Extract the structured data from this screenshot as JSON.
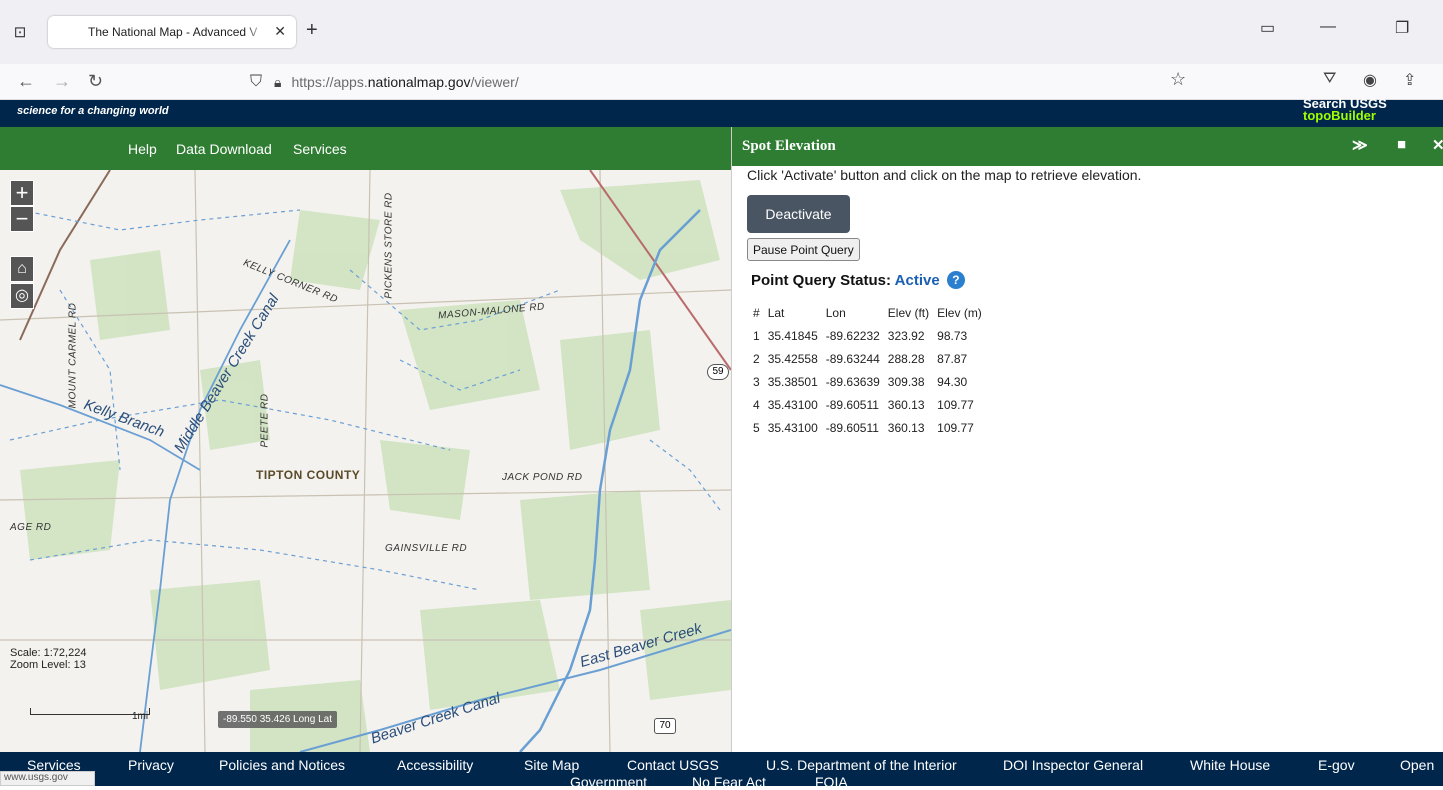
{
  "browser": {
    "tab_title": "The National Map - Advanced V",
    "url_prefix": "https://apps.",
    "url_domain": "nationalmap.gov",
    "url_path": "/viewer/",
    "icons": [
      "tab-list-icon",
      "close-icon",
      "new-tab-icon",
      "back-icon",
      "forward-icon",
      "reload-icon",
      "shield-icon",
      "lock-icon",
      "bookmark-star-icon",
      "pocket-icon",
      "account-icon",
      "share-icon"
    ]
  },
  "header": {
    "slogan": "science for a changing world",
    "search_usgs": "Search USGS",
    "topobuilder": "topoBuilder"
  },
  "menu": {
    "help": "Help",
    "data_download": "Data Download",
    "services": "Services"
  },
  "map": {
    "scale": "Scale: 1:72,224",
    "zoom": "Zoom Level: 13",
    "scale_unit": "1mi",
    "coords": "-89.550 35.426 Long Lat",
    "labels": {
      "kelly_corner": "KELLY CORNER RD",
      "pickens": "PICKENS STORE RD",
      "mason": "MASON-MALONE RD",
      "mount_carmel": "MOUNT CARMEL RD",
      "peete": "PEETE RD",
      "jack_pond": "JACK POND RD",
      "gainsville": "GAINSVILLE RD",
      "age": "AGE RD",
      "county": "TIPTON COUNTY",
      "kelly_branch": "Kelly Branch",
      "middle_beaver": "Middle Beaver Creek Canal",
      "east_beaver": "East Beaver Creek",
      "beaver_canal": "Beaver Creek Canal",
      "route_59": "59",
      "route_70": "70"
    }
  },
  "panel": {
    "title": "Spot Elevation",
    "instructions": "Click 'Activate' button and click on the map to retrieve elevation.",
    "deactivate": "Deactivate",
    "pause": "Pause Point Query",
    "status_label": "Point Query Status:",
    "status_value": "Active",
    "help": "?",
    "columns": [
      "#",
      "Lat",
      "Lon",
      "Elev (ft)",
      "Elev (m)"
    ],
    "rows": [
      [
        "1",
        "35.41845",
        "-89.62232",
        "323.92",
        "98.73"
      ],
      [
        "2",
        "35.42558",
        "-89.63244",
        "288.28",
        "87.87"
      ],
      [
        "3",
        "35.38501",
        "-89.63639",
        "309.38",
        "94.30"
      ],
      [
        "4",
        "35.43100",
        "-89.60511",
        "360.13",
        "109.77"
      ],
      [
        "5",
        "35.43100",
        "-89.60511",
        "360.13",
        "109.77"
      ]
    ]
  },
  "footer": {
    "services": "Services",
    "privacy": "Privacy",
    "policies": "Policies and Notices",
    "accessibility": "Accessibility",
    "sitemap": "Site Map",
    "contact": "Contact USGS",
    "doi": "U.S. Department of the Interior",
    "inspector": "DOI Inspector General",
    "whitehouse": "White House",
    "egov": "E-gov",
    "open": "Open",
    "government": "Government",
    "nofear": "No Fear Act",
    "foia": "FOIA",
    "status_url": "www.usgs.gov"
  },
  "colors": {
    "usgs_navy": "#00264c",
    "green": "#2e7d32",
    "topobuilder": "#9fff00",
    "button": "#4a5563"
  }
}
